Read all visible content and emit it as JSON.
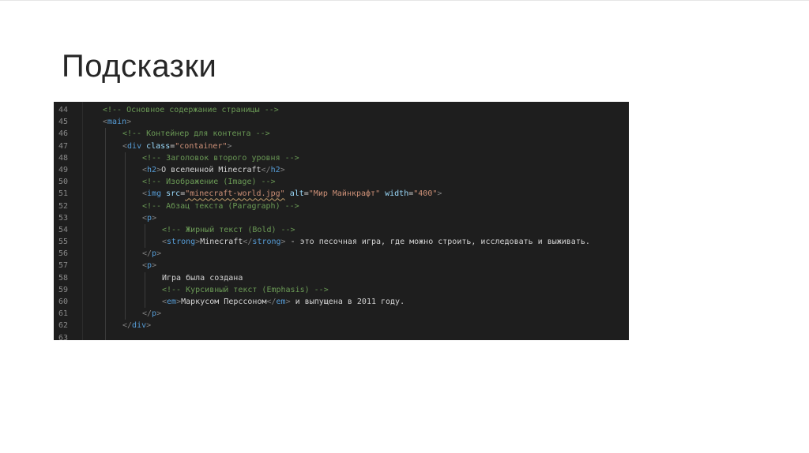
{
  "slide": {
    "title": "Подсказки"
  },
  "colors": {
    "background": "#ffffff",
    "editor_background": "#1e1e1e",
    "line_number": "#8a8a8a",
    "comment": "#6a9955",
    "punctuation": "#808080",
    "tag": "#569cd6",
    "attribute": "#9cdcfe",
    "string": "#ce9178",
    "text": "#d4d4d4"
  },
  "code": {
    "language": "html",
    "lines": [
      {
        "number": "44",
        "indent": 1,
        "tokens": [
          {
            "t": "comment",
            "v": "<!-- Основное содержание страницы -->"
          }
        ]
      },
      {
        "number": "45",
        "indent": 1,
        "tokens": [
          {
            "t": "punct",
            "v": "<"
          },
          {
            "t": "tag",
            "v": "main"
          },
          {
            "t": "punct",
            "v": ">"
          }
        ]
      },
      {
        "number": "46",
        "indent": 2,
        "tokens": [
          {
            "t": "comment",
            "v": "<!-- Контейнер для контента -->"
          }
        ]
      },
      {
        "number": "47",
        "indent": 2,
        "tokens": [
          {
            "t": "punct",
            "v": "<"
          },
          {
            "t": "tag",
            "v": "div"
          },
          {
            "t": "text",
            "v": " "
          },
          {
            "t": "attr",
            "v": "class"
          },
          {
            "t": "text",
            "v": "="
          },
          {
            "t": "str",
            "v": "\"container\""
          },
          {
            "t": "punct",
            "v": ">"
          }
        ]
      },
      {
        "number": "48",
        "indent": 3,
        "tokens": [
          {
            "t": "comment",
            "v": "<!-- Заголовок второго уровня -->"
          }
        ]
      },
      {
        "number": "49",
        "indent": 3,
        "tokens": [
          {
            "t": "punct",
            "v": "<"
          },
          {
            "t": "tag",
            "v": "h2"
          },
          {
            "t": "punct",
            "v": ">"
          },
          {
            "t": "text",
            "v": "О вселенной Minecraft"
          },
          {
            "t": "punct",
            "v": "</"
          },
          {
            "t": "tag",
            "v": "h2"
          },
          {
            "t": "punct",
            "v": ">"
          }
        ]
      },
      {
        "number": "50",
        "indent": 3,
        "tokens": [
          {
            "t": "comment",
            "v": "<!-- Изображение (Image) -->"
          }
        ]
      },
      {
        "number": "51",
        "indent": 3,
        "tokens": [
          {
            "t": "punct",
            "v": "<"
          },
          {
            "t": "tag",
            "v": "img"
          },
          {
            "t": "text",
            "v": " "
          },
          {
            "t": "attr",
            "v": "src"
          },
          {
            "t": "text",
            "v": "="
          },
          {
            "t": "str",
            "v": "\"minecraft-world.jpg\"",
            "u": true
          },
          {
            "t": "text",
            "v": " "
          },
          {
            "t": "attr",
            "v": "alt"
          },
          {
            "t": "text",
            "v": "="
          },
          {
            "t": "str",
            "v": "\"Мир Майнкрафт\""
          },
          {
            "t": "text",
            "v": " "
          },
          {
            "t": "attr",
            "v": "width"
          },
          {
            "t": "text",
            "v": "="
          },
          {
            "t": "str",
            "v": "\"400\""
          },
          {
            "t": "punct",
            "v": ">"
          }
        ]
      },
      {
        "number": "52",
        "indent": 3,
        "tokens": [
          {
            "t": "comment",
            "v": "<!-- Абзац текста (Paragraph) -->"
          }
        ]
      },
      {
        "number": "53",
        "indent": 3,
        "tokens": [
          {
            "t": "punct",
            "v": "<"
          },
          {
            "t": "tag",
            "v": "p"
          },
          {
            "t": "punct",
            "v": ">"
          }
        ]
      },
      {
        "number": "54",
        "indent": 4,
        "tokens": [
          {
            "t": "comment",
            "v": "<!-- Жирный текст (Bold) -->"
          }
        ]
      },
      {
        "number": "55",
        "indent": 4,
        "tokens": [
          {
            "t": "punct",
            "v": "<"
          },
          {
            "t": "tag",
            "v": "strong"
          },
          {
            "t": "punct",
            "v": ">"
          },
          {
            "t": "text",
            "v": "Minecraft"
          },
          {
            "t": "punct",
            "v": "</"
          },
          {
            "t": "tag",
            "v": "strong"
          },
          {
            "t": "punct",
            "v": ">"
          },
          {
            "t": "text",
            "v": " - это песочная игра, где можно строить, исследовать и выживать."
          }
        ]
      },
      {
        "number": "56",
        "indent": 3,
        "tokens": [
          {
            "t": "punct",
            "v": "</"
          },
          {
            "t": "tag",
            "v": "p"
          },
          {
            "t": "punct",
            "v": ">"
          }
        ]
      },
      {
        "number": "57",
        "indent": 3,
        "tokens": [
          {
            "t": "punct",
            "v": "<"
          },
          {
            "t": "tag",
            "v": "p"
          },
          {
            "t": "punct",
            "v": ">"
          }
        ]
      },
      {
        "number": "58",
        "indent": 4,
        "tokens": [
          {
            "t": "text",
            "v": "Игра была создана"
          }
        ]
      },
      {
        "number": "59",
        "indent": 4,
        "tokens": [
          {
            "t": "comment",
            "v": "<!-- Курсивный текст (Emphasis) -->"
          }
        ]
      },
      {
        "number": "60",
        "indent": 4,
        "tokens": [
          {
            "t": "punct",
            "v": "<"
          },
          {
            "t": "tag",
            "v": "em"
          },
          {
            "t": "punct",
            "v": ">"
          },
          {
            "t": "text",
            "v": "Маркусом Перссоном"
          },
          {
            "t": "punct",
            "v": "</"
          },
          {
            "t": "tag",
            "v": "em"
          },
          {
            "t": "punct",
            "v": ">"
          },
          {
            "t": "text",
            "v": " и выпущена в 2011 году."
          }
        ]
      },
      {
        "number": "61",
        "indent": 3,
        "tokens": [
          {
            "t": "punct",
            "v": "</"
          },
          {
            "t": "tag",
            "v": "p"
          },
          {
            "t": "punct",
            "v": ">"
          }
        ]
      },
      {
        "number": "62",
        "indent": 2,
        "tokens": [
          {
            "t": "punct",
            "v": "</"
          },
          {
            "t": "tag",
            "v": "div"
          },
          {
            "t": "punct",
            "v": ">"
          }
        ]
      },
      {
        "number": "63",
        "indent": 0,
        "tokens": []
      }
    ]
  }
}
